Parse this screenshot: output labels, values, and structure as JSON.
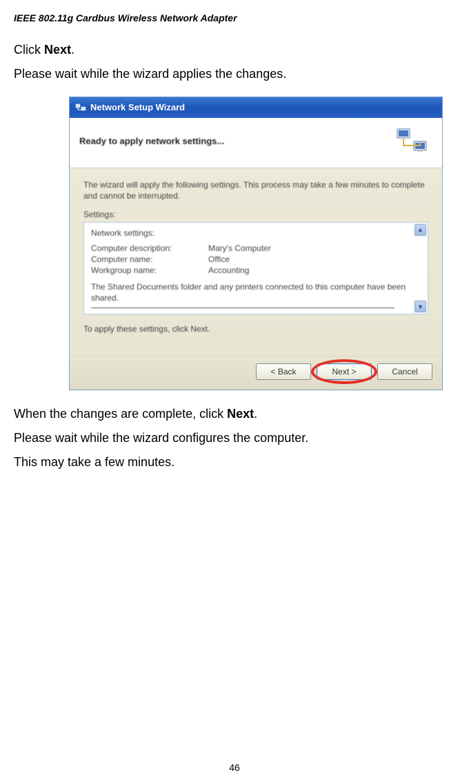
{
  "header": {
    "title": "IEEE 802.11g Cardbus Wireless Network Adapter"
  },
  "body": {
    "line1_prefix": "Click ",
    "line1_bold": "Next",
    "line1_suffix": ".",
    "line2": "Please wait while the wizard applies the changes.",
    "post1_prefix": "When the changes are complete, click ",
    "post1_bold": "Next",
    "post1_suffix": ".",
    "post2": "Please wait while the wizard configures the computer.",
    "post3": "This may take a few minutes."
  },
  "wizard": {
    "titlebar": "Network Setup Wizard",
    "header_title": "Ready to apply network settings...",
    "intro": "The wizard will apply the following settings. This process may take a few minutes to complete and cannot be interrupted.",
    "settings_label": "Settings:",
    "settings_heading": "Network settings:",
    "rows": [
      {
        "label": "Computer description:",
        "value": "Mary's Computer"
      },
      {
        "label": "Computer name:",
        "value": "Office"
      },
      {
        "label": "Workgroup name:",
        "value": "Accounting"
      }
    ],
    "shared": "The Shared Documents folder and any printers connected to this computer have been shared.",
    "apply_hint": "To apply these settings, click Next.",
    "buttons": {
      "back": "< Back",
      "next": "Next >",
      "cancel": "Cancel"
    }
  },
  "page_number": "46"
}
